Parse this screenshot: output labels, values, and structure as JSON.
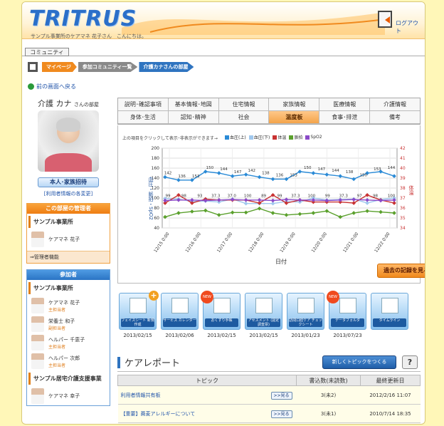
{
  "header": {
    "logo": "TRITRUS",
    "greeting": "サンプル事業所のケアマネ 花子さん　こんにちは。",
    "logout_label": "ログアウト"
  },
  "community_tab": "コミュニティ",
  "breadcrumb": [
    "マイページ",
    "参加コミュニティ一覧",
    "介護カナさんの部屋"
  ],
  "back_link": "前の画面へ戻る",
  "profile": {
    "name": "介護 カナ",
    "suffix": "さんの部屋",
    "invite_button": "本人･家族招待",
    "info_link": "[利用者情報の各変更]"
  },
  "admin_box": {
    "title": "この部屋の管理者",
    "org": "サンプル事業所",
    "member_name": "ケアマネ 花子",
    "admin_link": "⇒管理者機能"
  },
  "participants_box": {
    "title": "参加者",
    "orgs": [
      {
        "name": "サンプル事業所",
        "members": [
          {
            "name": "ケアマネ 花子",
            "role": "主担当者"
          },
          {
            "name": "栄養士 和子",
            "role": "副担当者"
          },
          {
            "name": "ヘルパー 千恵子",
            "role": "主担当者"
          },
          {
            "name": "ヘルパー 次郎",
            "role": "主担当者"
          }
        ]
      },
      {
        "name": "サンプル居宅介護支援事業",
        "members": [
          {
            "name": "ケアマネ 幸子",
            "role": ""
          }
        ]
      }
    ]
  },
  "tabs_row1": [
    "説明･確認事項",
    "基本情報･地図",
    "住宅情報",
    "家族情報",
    "医療情報",
    "介護情報"
  ],
  "tabs_row2": [
    "身体･生活",
    "認知･精神",
    "社会",
    "温度板",
    "食事･排泄",
    "備考"
  ],
  "active_tab": "温度板",
  "chart_hint": "上の項目をクリックして表示･非表示ができます→",
  "history_button": "過去の記録を見る",
  "chart_data": {
    "type": "line",
    "xlabel": "日付",
    "ylabel": "血圧・脈拍・SpO2",
    "y2label": "体温",
    "ylim": [
      40,
      200
    ],
    "y2lim": [
      34,
      42
    ],
    "x": [
      "12/15 0:00",
      "12/16 0:00",
      "12/17 0:00",
      "12/18 0:00",
      "12/19 0:00",
      "12/20 0:00",
      "12/21 0:00",
      "12/22 0:00"
    ],
    "series": [
      {
        "name": "血圧(上)",
        "color": "#2a8ad6",
        "values": [
          142,
          136,
          136,
          153,
          150,
          144,
          147,
          142,
          138,
          138,
          153,
          150,
          147,
          144,
          138,
          150,
          153,
          144
        ]
      },
      {
        "name": "血圧(下)",
        "color": "#a0c8ee",
        "values": [
          99,
          98,
          93,
          94,
          92,
          98,
          89,
          89,
          89,
          93,
          92,
          100,
          96,
          97,
          98,
          90,
          97,
          100
        ]
      },
      {
        "name": "体温",
        "color": "#c83232",
        "values": [
          36.5,
          37.3,
          36.5,
          36.9,
          36.8,
          36.8,
          36.8,
          36.5,
          37.3,
          36.5,
          36.8,
          36.6,
          36.6,
          36.6,
          36.5,
          37.3,
          36.8,
          36.5
        ]
      },
      {
        "name": "脈拍",
        "color": "#5aa02c",
        "values": [
          62,
          70,
          73,
          75,
          66,
          71,
          71,
          79,
          70,
          66,
          68,
          70,
          74,
          62,
          70,
          74,
          72,
          70
        ]
      },
      {
        "name": "SpO2",
        "color": "#8a4ac8",
        "values": [
          95,
          96,
          96,
          95,
          96,
          97,
          96,
          96,
          95,
          97,
          96,
          96,
          95,
          96,
          97,
          96,
          95,
          96
        ]
      }
    ],
    "value_labels_upper": [
      "142",
      "136",
      "153",
      "150",
      "144",
      "147",
      "142",
      "138",
      "136",
      "153",
      "150",
      "147",
      "144",
      "138",
      "150",
      "153",
      "144"
    ],
    "value_labels_lower": [
      "99",
      "98",
      "93",
      "37.3",
      "37.0",
      "100",
      "89",
      "99",
      "37.3",
      "100",
      "99",
      "37.3",
      "97",
      "98",
      "100"
    ]
  },
  "icons": [
    {
      "label": "フェイスシート\n新規作成",
      "date": "2013/02/15",
      "badge": "+"
    },
    {
      "label": "サービス\nカレンダー",
      "date": "2013/02/06",
      "badge": ""
    },
    {
      "label": "おくすり手帳",
      "date": "2013/02/15",
      "badge": "NEW"
    },
    {
      "label": "アセスメント\n(認定調査票)",
      "date": "2013/02/15",
      "badge": ""
    },
    {
      "label": "訪問口腔ケア\nチェックシート",
      "date": "2013/01/23",
      "badge": ""
    },
    {
      "label": "データフォルダ",
      "date": "2013/07/23",
      "badge": "NEW"
    },
    {
      "label": "タイムライン",
      "date": "",
      "badge": ""
    }
  ],
  "care_report": {
    "title": "ケアレポート",
    "new_topic": "新しくトピックをつくる",
    "help": "?",
    "columns": [
      "トピック",
      "書込数(未読数)",
      "最終更新日"
    ],
    "view_label": ">>見る",
    "rows": [
      {
        "topic": "利用者情報共有板",
        "count": "3(未2)",
        "updated": "2012/2/16 11:07"
      },
      {
        "topic": "【重要】蕎麦アレルギーについて",
        "count": "3(未1)",
        "updated": "2010/7/14 18:35"
      }
    ]
  }
}
